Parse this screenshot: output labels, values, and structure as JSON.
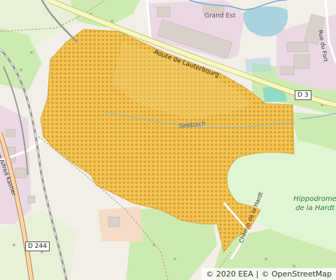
{
  "map": {
    "roads": {
      "route_lauterbourg": "Route de Lauterbourg",
      "d3": "D 3",
      "d244": "D 244",
      "alfred_kastler": "Rue Alfred Kastler",
      "chemin_hardt": "Chemin de la Hardt",
      "rue_fort": "Rue du Fort"
    },
    "places": {
      "grand_est": "Grand Est",
      "hippodrome_line1": "Hippodrome",
      "hippodrome_line2": "de la Hardt"
    },
    "water": {
      "stream": "Seebach"
    },
    "attribution": {
      "eea": "© 2020 EEA",
      "separator": "|",
      "osm": "© OpenStreetMap"
    },
    "colors": {
      "background": "#f2efe9",
      "industrial": "#ebd8e5",
      "building": "#d9d0c9",
      "meadow": "#cdebb0",
      "racecourse": "#dff5d3",
      "water": "#aad3df",
      "highlight_fill": "#ecbe3a",
      "highlight_pattern": "#e3a323",
      "road_main": "#f7fabf",
      "road_secondary": "#fcd6a4",
      "rail": "#999999"
    }
  }
}
